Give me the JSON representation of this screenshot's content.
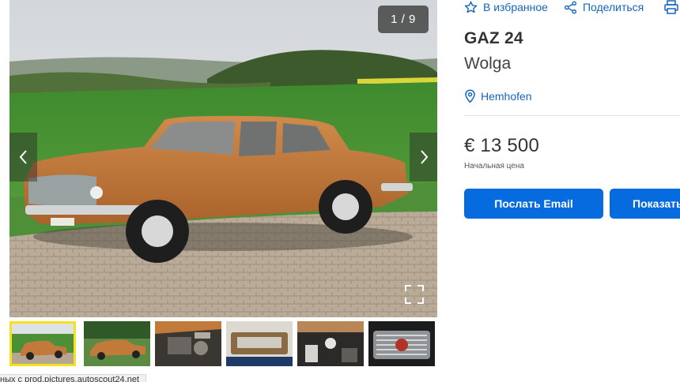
{
  "gallery": {
    "counter": "1 / 9",
    "prev_icon": "chevron-left-icon",
    "next_icon": "chevron-right-icon",
    "fullscreen_icon": "expand-icon",
    "thumbnails": [
      {
        "name": "thumb-car-side-field",
        "active": true
      },
      {
        "name": "thumb-car-side-trees",
        "active": false
      },
      {
        "name": "thumb-engine-bay",
        "active": false
      },
      {
        "name": "thumb-radio-panel",
        "active": false
      },
      {
        "name": "thumb-interior-pedals",
        "active": false
      },
      {
        "name": "thumb-grille-emblem",
        "active": false
      }
    ]
  },
  "status_tooltip": "ных с prod.pictures.autoscout24.net",
  "actions": {
    "favorite_label": "В избранное",
    "share_label": "Поделиться",
    "favorite_icon": "star-icon",
    "share_icon": "share-icon",
    "print_icon": "printer-icon"
  },
  "listing": {
    "make": "GAZ 24",
    "model": "Wolga",
    "location": "Hemhofen",
    "location_icon": "map-pin-icon",
    "price": "€ 13 500",
    "price_note": "Начальная цена"
  },
  "buttons": {
    "email_label": "Послать Email",
    "call_label": "Показать номер",
    "call_icon": "phone-icon"
  },
  "colors": {
    "accent_blue": "#076be0",
    "link_blue": "#1565c0",
    "active_thumb_border": "#f5e11d",
    "car_body": "#c27a3b"
  }
}
